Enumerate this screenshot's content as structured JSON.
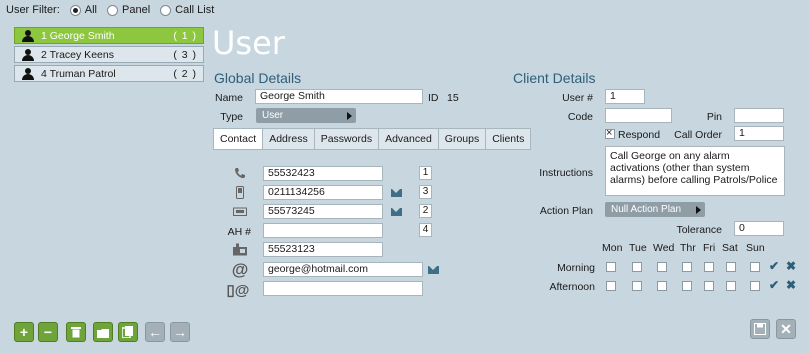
{
  "filter": {
    "label": "User Filter:",
    "options": [
      {
        "label": "All",
        "selected": true
      },
      {
        "label": "Panel",
        "selected": false
      },
      {
        "label": "Call List",
        "selected": false
      }
    ]
  },
  "users": [
    {
      "name": "1 George Smith",
      "count": "( 1 )",
      "selected": true
    },
    {
      "name": "2 Tracey Keens",
      "count": "( 3 )",
      "selected": false
    },
    {
      "name": "4 Truman Patrol",
      "count": "( 2 )",
      "selected": false
    }
  ],
  "page_title": "User",
  "global": {
    "title": "Global Details",
    "name_label": "Name",
    "name_value": "George Smith",
    "id_label": "ID",
    "id_value": "15",
    "type_label": "Type",
    "type_value": "User"
  },
  "tabs": [
    "Contact",
    "Address",
    "Passwords",
    "Advanced",
    "Groups",
    "Clients"
  ],
  "contact": {
    "ah_label": "AH #",
    "rows": [
      {
        "icon": "phone-icon",
        "value": "55532423",
        "order": "1"
      },
      {
        "icon": "mobile-icon",
        "value": "0211134256",
        "order": "3"
      },
      {
        "icon": "fax-icon",
        "value": "55573245",
        "order": "2"
      },
      {
        "icon": "",
        "value": "",
        "order": "4"
      },
      {
        "icon": "desk-phone-icon",
        "value": "55523123",
        "order": ""
      },
      {
        "icon": "email-icon",
        "value": "george@hotmail.com",
        "order": ""
      },
      {
        "icon": "mobile-email-icon",
        "value": "",
        "order": ""
      }
    ]
  },
  "client": {
    "title": "Client Details",
    "user_num_label": "User #",
    "user_num_value": "1",
    "code_label": "Code",
    "code_value": "",
    "pin_label": "Pin",
    "pin_value": "",
    "respond_label": "Respond",
    "respond_checked": true,
    "call_order_label": "Call Order",
    "call_order_value": "1",
    "instructions_label": "Instructions",
    "instructions_value": "Call George on any alarm activations (other than system alarms) before calling Patrols/Police",
    "action_plan_label": "Action Plan",
    "action_plan_value": "Null Action Plan",
    "tolerance_label": "Tolerance",
    "tolerance_value": "0",
    "days": [
      "Mon",
      "Tue",
      "Wed",
      "Thr",
      "Fri",
      "Sat",
      "Sun"
    ],
    "periods": [
      "Morning",
      "Afternoon"
    ]
  },
  "colors": {
    "selected": "#8dc63f",
    "accent": "#2e5f7a",
    "background": "#c8d6df"
  }
}
